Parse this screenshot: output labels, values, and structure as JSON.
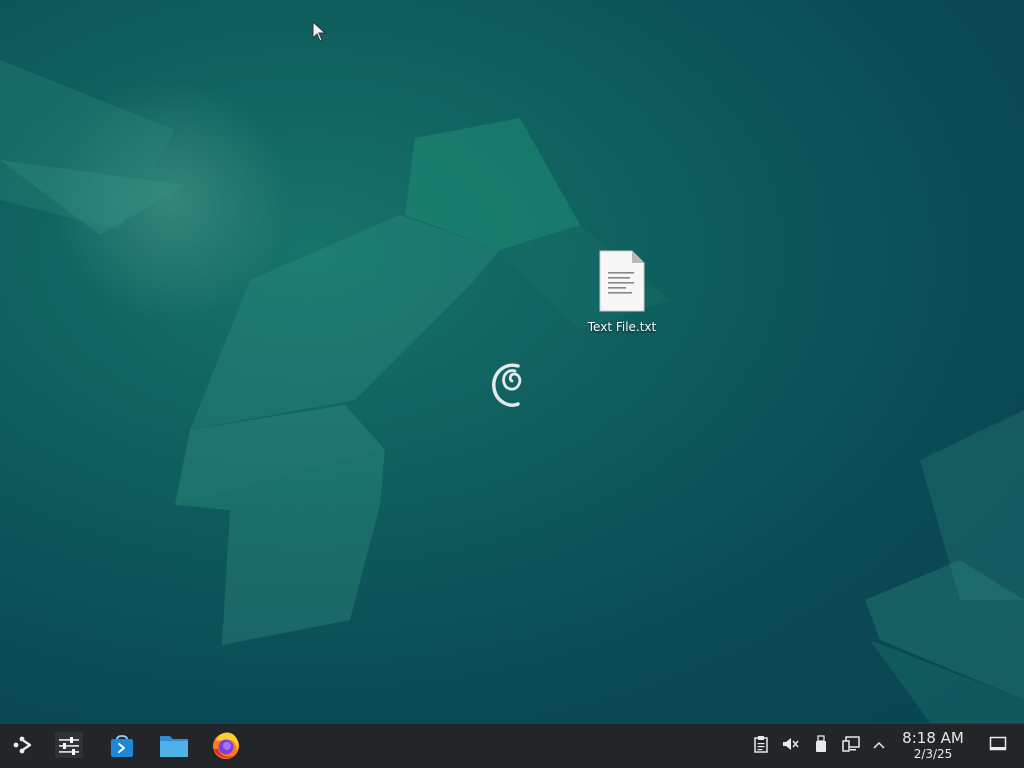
{
  "desktop": {
    "files": [
      {
        "name": "Text File.txt",
        "icon": "text-file-icon"
      }
    ],
    "logo": "debian-swirl-logo",
    "colors": {
      "wallpaper_dark": "#094552",
      "wallpaper_light": "#17746a"
    }
  },
  "taskbar": {
    "launcher": {
      "icon": "application-launcher-icon"
    },
    "pinned_apps": [
      {
        "name": "System Settings",
        "icon": "settings-sliders-icon"
      },
      {
        "name": "Discover",
        "icon": "software-store-icon"
      },
      {
        "name": "Dolphin",
        "icon": "folder-icon"
      },
      {
        "name": "Firefox",
        "icon": "firefox-icon"
      }
    ],
    "tray": [
      {
        "name": "clipboard",
        "icon": "clipboard-icon"
      },
      {
        "name": "volume",
        "icon": "volume-muted-icon"
      },
      {
        "name": "removable-devices",
        "icon": "usb-drive-icon"
      },
      {
        "name": "network",
        "icon": "network-wired-icon"
      },
      {
        "name": "show-hidden",
        "icon": "chevron-up-icon"
      }
    ],
    "clock": {
      "time": "8:18 AM",
      "date": "2/3/25"
    },
    "show_desktop": {
      "icon": "show-desktop-icon"
    },
    "colors": {
      "panel": "#222629",
      "text": "#e8eaec"
    }
  }
}
